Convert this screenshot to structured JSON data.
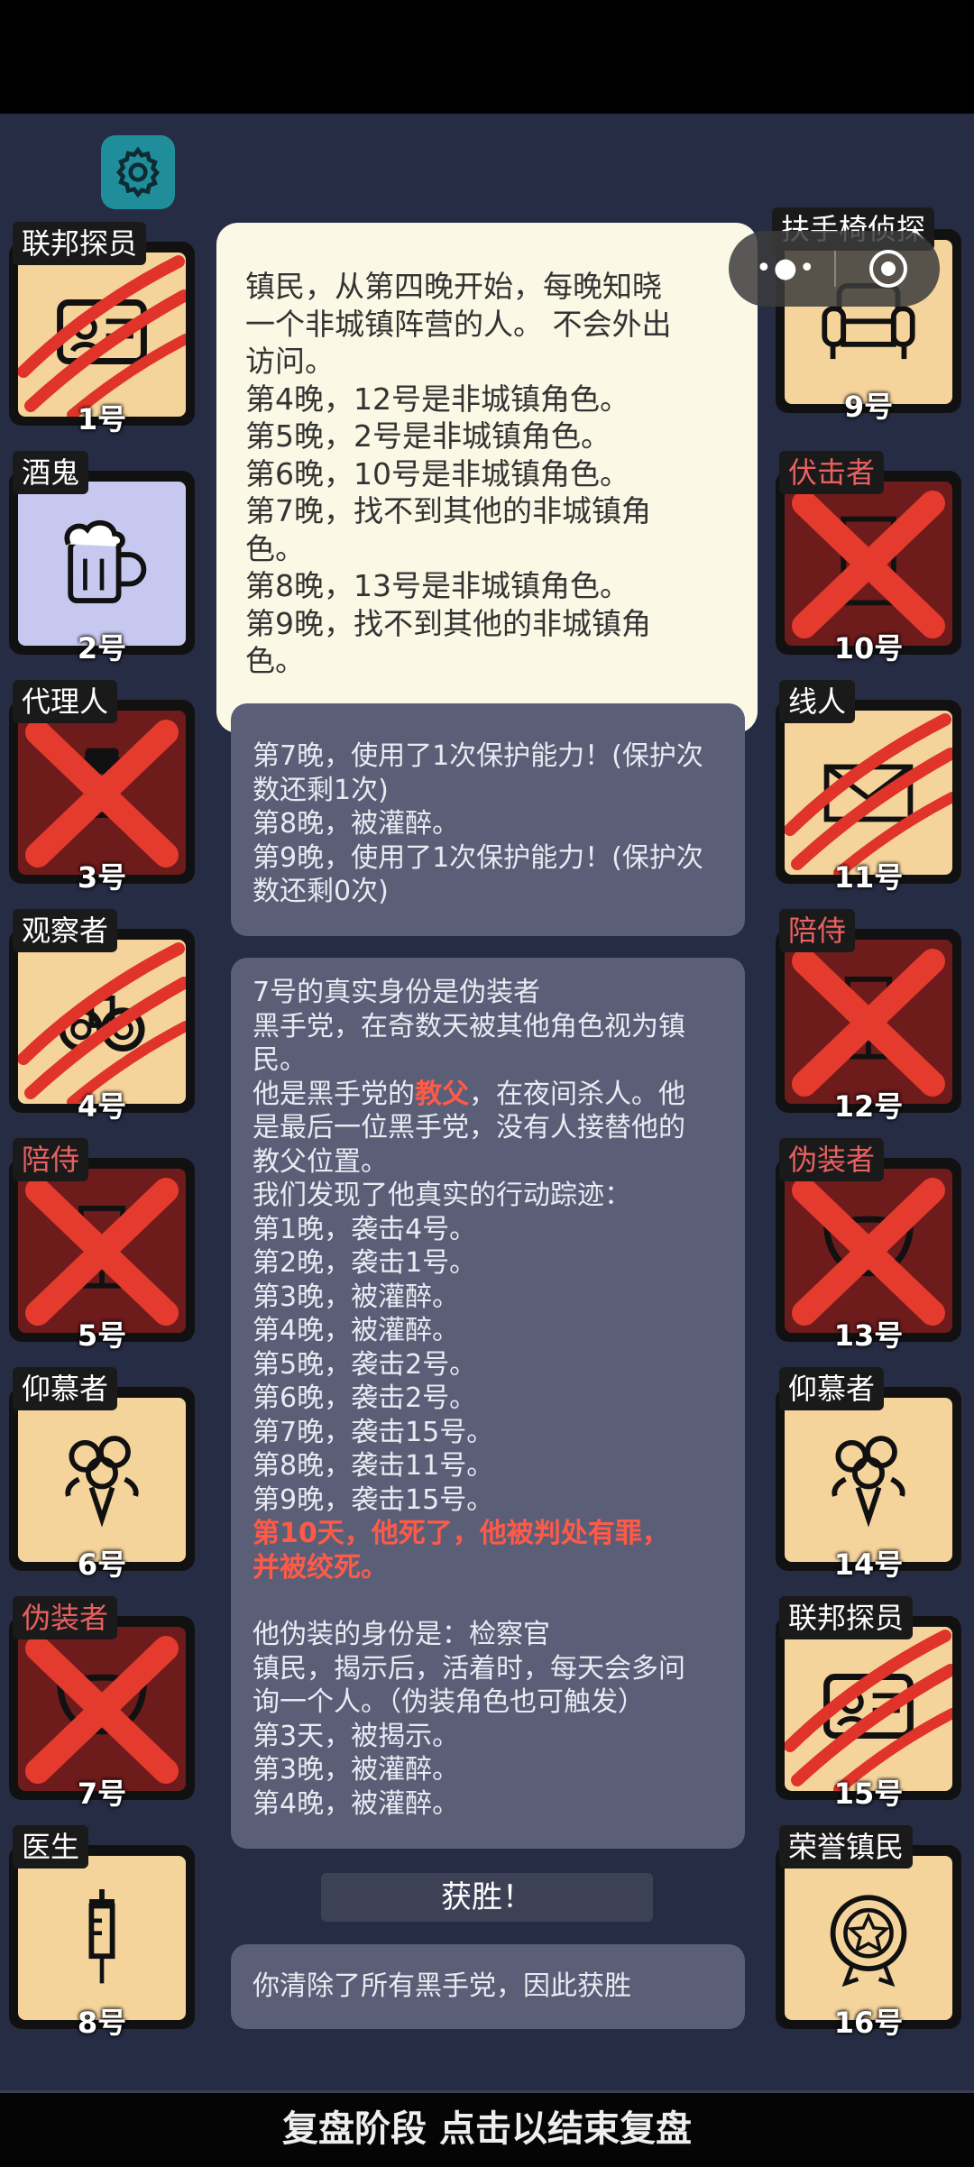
{
  "colors": {
    "background": "#272c45",
    "popup": "#fbf8e6",
    "panel": "#5a5f77",
    "highlight": "#ff5a48"
  },
  "settings_icon": "gear-icon",
  "capsule_icons": [
    "more-dots-icon",
    "close-target-icon"
  ],
  "players": [
    {
      "role": "联邦探员",
      "number": "1号",
      "icon": "id-card-icon",
      "status": "clawed",
      "tone": "tan"
    },
    {
      "role": "酒鬼",
      "number": "2号",
      "icon": "beer-mug-icon",
      "status": "alive",
      "tone": "lav"
    },
    {
      "role": "代理人",
      "number": "3号",
      "icon": "agent-icon",
      "status": "crossed",
      "tone": "red",
      "evil": false
    },
    {
      "role": "观察者",
      "number": "4号",
      "icon": "binoculars-icon",
      "status": "clawed",
      "tone": "tan"
    },
    {
      "role": "陪侍",
      "number": "5号",
      "icon": "wine-glass-icon",
      "status": "crossed",
      "tone": "red",
      "evil": true
    },
    {
      "role": "仰慕者",
      "number": "6号",
      "icon": "rose-bouquet-icon",
      "status": "alive",
      "tone": "tan"
    },
    {
      "role": "伪装者",
      "number": "7号",
      "icon": "mask-icon",
      "status": "crossed",
      "tone": "red",
      "evil": true
    },
    {
      "role": "医生",
      "number": "8号",
      "icon": "syringe-icon",
      "status": "alive",
      "tone": "tan"
    },
    {
      "role": "扶手椅侦探",
      "number": "9号",
      "icon": "armchair-icon",
      "status": "alive",
      "tone": "tan"
    },
    {
      "role": "伏击者",
      "number": "10号",
      "icon": "door-icon",
      "status": "crossed",
      "tone": "red",
      "evil": true
    },
    {
      "role": "线人",
      "number": "11号",
      "icon": "envelope-icon",
      "status": "clawed",
      "tone": "tan"
    },
    {
      "role": "陪侍",
      "number": "12号",
      "icon": "wine-glass-icon",
      "status": "crossed",
      "tone": "red",
      "evil": true
    },
    {
      "role": "伪装者",
      "number": "13号",
      "icon": "mask-icon",
      "status": "crossed",
      "tone": "red",
      "evil": true
    },
    {
      "role": "仰慕者",
      "number": "14号",
      "icon": "rose-bouquet-icon",
      "status": "alive",
      "tone": "tan"
    },
    {
      "role": "联邦探员",
      "number": "15号",
      "icon": "id-card-icon",
      "status": "clawed",
      "tone": "tan"
    },
    {
      "role": "荣誉镇民",
      "number": "16号",
      "icon": "medal-icon",
      "status": "alive",
      "tone": "tan"
    }
  ],
  "popup": {
    "lines": [
      "镇民，从第四晚开始，每晚知晓",
      "一个非城镇阵营的人。 不会外出",
      "访问。",
      "第4晚，12号是非城镇角色。",
      "第5晚，2号是非城镇角色。",
      "第6晚，10号是非城镇角色。",
      "第7晚，找不到其他的非城镇角",
      "色。",
      "第8晚，13号是非城镇角色。",
      "第9晚，找不到其他的非城镇角",
      "色。"
    ]
  },
  "panel_a": {
    "lines": [
      "第7晚，使用了1次保护能力！(保护次",
      "数还剩1次)",
      "第8晚，被灌醉。",
      "第9晚，使用了1次保护能力！(保护次",
      "数还剩0次)"
    ]
  },
  "panel_b": {
    "l1": "7号的真实身份是伪装者",
    "l2": "黑手党，在奇数天被其他角色视为镇",
    "l3": "民。",
    "l4a": "他是黑手党的",
    "l4kw": "教父",
    "l4b": "，在夜间杀人。他",
    "l5": "是最后一位黑手党，没有人接替他的",
    "l6": "教父位置。",
    "l7": "我们发现了他真实的行动踪迹：",
    "nights": [
      "第1晚，袭击4号。",
      "第2晚，袭击1号。",
      "第3晚，被灌醉。",
      "第4晚，被灌醉。",
      "第5晚，袭击2号。",
      "第6晚，袭击2号。",
      "第7晚，袭击15号。",
      "第8晚，袭击11号。",
      "第9晚，袭击15号。"
    ],
    "death1": "第10天，他死了，他被判处有罪，",
    "death2": "并被绞死。",
    "disguise": [
      "他伪装的身份是：检察官",
      "镇民，揭示后，活着时，每天会多问",
      "询一个人。（伪装角色也可触发）",
      "第3天，被揭示。",
      "第3晚，被灌醉。",
      "第4晚，被灌醉。"
    ]
  },
  "win_button": "获胜！",
  "panel_c": "你清除了所有黑手党，因此获胜",
  "bottom_bar": "复盘阶段 点击以结束复盘"
}
